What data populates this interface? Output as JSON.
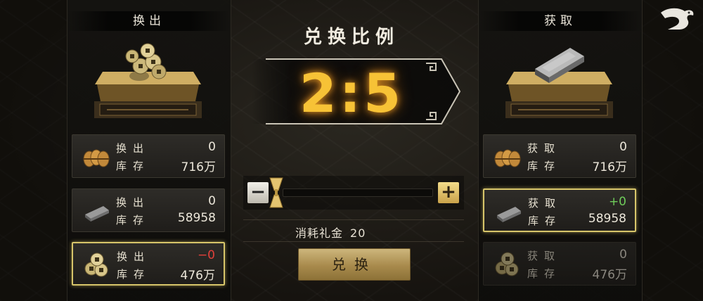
{
  "header": {
    "title": "兑换比例"
  },
  "ratio": {
    "text": "2:5"
  },
  "left_panel": {
    "title": "换出",
    "slots": [
      {
        "icon": "copper-coin-bundle-icon",
        "label1": "换出",
        "label2": "库存",
        "value1": "0",
        "value2": "716万",
        "value1_color": "#ece7da"
      },
      {
        "icon": "silver-ingot-icon",
        "label1": "换出",
        "label2": "库存",
        "value1": "0",
        "value2": "58958",
        "value1_color": "#ece7da"
      },
      {
        "icon": "gold-coins-icon",
        "label1": "换出",
        "label2": "库存",
        "value1": "−0",
        "value2": "476万",
        "value1_color": "#e0403a",
        "selected": true
      }
    ]
  },
  "right_panel": {
    "title": "获取",
    "slots": [
      {
        "icon": "copper-coin-bundle-icon",
        "label1": "获取",
        "label2": "库存",
        "value1": "0",
        "value2": "716万",
        "value1_color": "#ece7da"
      },
      {
        "icon": "silver-ingot-icon",
        "label1": "获取",
        "label2": "库存",
        "value1": "+0",
        "value2": "58958",
        "value1_color": "#6fcc5a",
        "selected": true
      },
      {
        "icon": "gold-coins-icon",
        "label1": "获取",
        "label2": "库存",
        "value1": "0",
        "value2": "476万",
        "value1_color": "#ece7da",
        "disabled": true
      }
    ]
  },
  "slider": {
    "minus_label": "−",
    "plus_label": "+",
    "value_fraction": 0.0
  },
  "cost": {
    "label": "消耗礼金",
    "value": "20"
  },
  "exchange_button": {
    "label": "兑换"
  },
  "colors": {
    "ratio_gold": "#f7c236",
    "selected_border": "#d7c56a",
    "negative": "#e0403a",
    "positive": "#6fcc5a"
  }
}
